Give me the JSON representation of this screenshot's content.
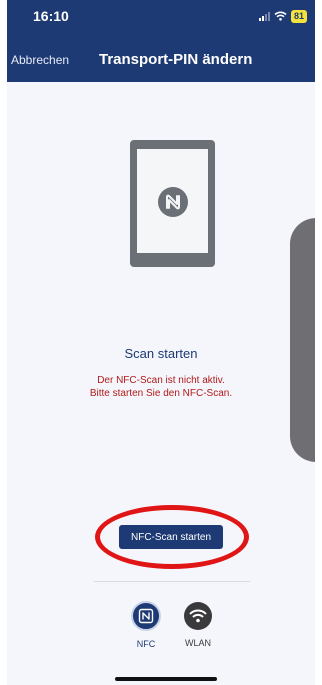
{
  "status_bar": {
    "time": "16:10",
    "battery": "81"
  },
  "nav": {
    "cancel_label": "Abbrechen",
    "title": "Transport-PIN ändern"
  },
  "scan": {
    "heading": "Scan starten",
    "message_line1": "Der NFC-Scan ist nicht aktiv.",
    "message_line2": "Bitte starten Sie den NFC-Scan.",
    "start_button_label": "NFC-Scan starten"
  },
  "tabs": [
    {
      "label": "NFC",
      "icon": "nfc-icon",
      "selected": true
    },
    {
      "label": "WLAN",
      "icon": "wifi-icon",
      "selected": false
    }
  ],
  "colors": {
    "brand": "#1e3a74",
    "error": "#b11a1a",
    "highlight": "#e01515",
    "battery": "#f5e23d"
  }
}
